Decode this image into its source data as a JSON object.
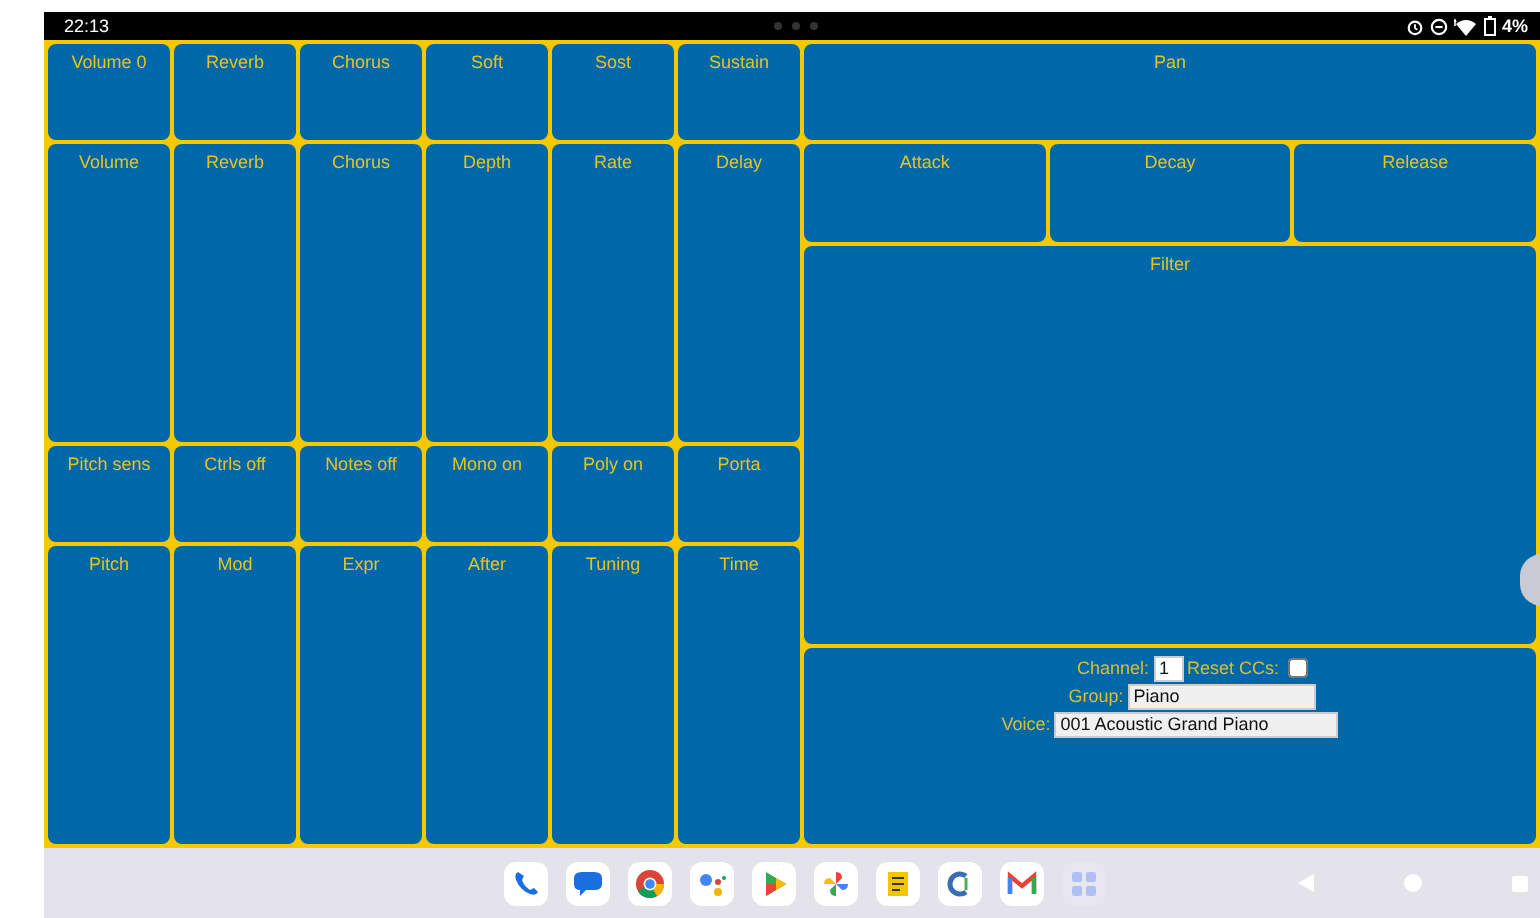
{
  "status_bar": {
    "time": "22:13",
    "battery": "4%"
  },
  "left_pads": [
    {
      "kind": "short",
      "labels": [
        "Volume 0",
        "Reverb",
        "Chorus",
        "Soft",
        "Sost",
        "Sustain"
      ]
    },
    {
      "kind": "tall",
      "labels": [
        "Volume",
        "Reverb",
        "Chorus",
        "Depth",
        "Rate",
        "Delay"
      ]
    },
    {
      "kind": "short",
      "labels": [
        "Pitch sens",
        "Ctrls off",
        "Notes off",
        "Mono on",
        "Poly on",
        "Porta"
      ]
    },
    {
      "kind": "tall",
      "labels": [
        "Pitch",
        "Mod",
        "Expr",
        "After",
        "Tuning",
        "Time"
      ]
    }
  ],
  "pan": {
    "label": "Pan"
  },
  "envelope": [
    "Attack",
    "Decay",
    "Release"
  ],
  "filter": {
    "label": "Filter"
  },
  "settings": {
    "channel_label": "Channel:",
    "channel": "1",
    "reset_label": "Reset CCs:",
    "reset_checked": false,
    "group_label": "Group:",
    "group": "Piano",
    "voice_label": "Voice:",
    "voice": "001 Acoustic Grand Piano"
  }
}
